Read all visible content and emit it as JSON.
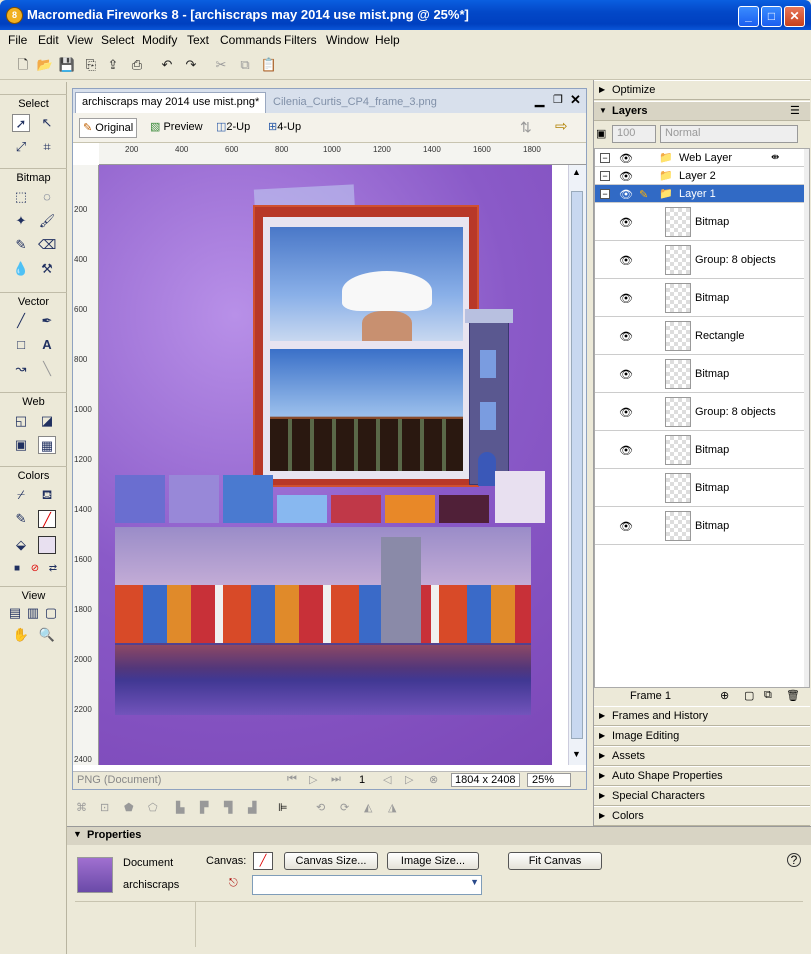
{
  "window": {
    "title": "Macromedia Fireworks 8 - [archiscraps may 2014 use mist.png @  25%*]",
    "app_icon_text": "8"
  },
  "menu": [
    "File",
    "Edit",
    "View",
    "Select",
    "Modify",
    "Text",
    "Commands",
    "Filters",
    "Window",
    "Help"
  ],
  "tools": {
    "sections": [
      "Select",
      "Bitmap",
      "Vector",
      "Web",
      "Colors",
      "View"
    ]
  },
  "document": {
    "tabs": [
      "archiscraps may 2014 use mist.png*",
      "Cilenia_Curtis_CP4_frame_3.png"
    ],
    "view_buttons": [
      "Original",
      "Preview",
      "2-Up",
      "4-Up"
    ],
    "ruler_h": [
      "200",
      "400",
      "600",
      "800",
      "1000",
      "1200",
      "1400",
      "1600",
      "1800"
    ],
    "ruler_v": [
      "200",
      "400",
      "600",
      "800",
      "1000",
      "1200",
      "1400",
      "1600",
      "1800",
      "2000",
      "2200",
      "2400"
    ],
    "status_type": "PNG (Document)",
    "frame_number": "1",
    "dimensions": "1804 x 2408",
    "zoom": "25%"
  },
  "right_panels": {
    "optimize": "Optimize",
    "layers_title": "Layers",
    "opacity": "100",
    "blend": "Normal",
    "layers": [
      {
        "name": "Web Layer",
        "type": "folder"
      },
      {
        "name": "Layer 2",
        "type": "folder"
      },
      {
        "name": "Layer 1",
        "type": "folder",
        "selected": true
      },
      {
        "name": "Bitmap",
        "type": "object"
      },
      {
        "name": "Group: 8 objects",
        "type": "object"
      },
      {
        "name": "Bitmap",
        "type": "object"
      },
      {
        "name": "Rectangle",
        "type": "object"
      },
      {
        "name": "Bitmap",
        "type": "object"
      },
      {
        "name": "Group: 8 objects",
        "type": "object"
      },
      {
        "name": "Bitmap",
        "type": "object"
      },
      {
        "name": "Bitmap",
        "type": "object"
      },
      {
        "name": "Bitmap",
        "type": "object"
      }
    ],
    "frame_label": "Frame 1",
    "collapsed": [
      "Frames and History",
      "Image Editing",
      "Assets",
      "Auto Shape Properties",
      "Special Characters",
      "Colors"
    ]
  },
  "properties": {
    "title": "Properties",
    "doc_label": "Document",
    "doc_name": "archiscraps",
    "canvas_label": "Canvas:",
    "buttons": [
      "Canvas Size...",
      "Image Size...",
      "Fit Canvas"
    ]
  },
  "colors": {
    "swatches": [
      "#6a6ed0",
      "#9888d8",
      "#4a7ad0",
      "#88b8f0",
      "#c03848",
      "#e88828",
      "#502038",
      "#e8e0f0"
    ]
  }
}
